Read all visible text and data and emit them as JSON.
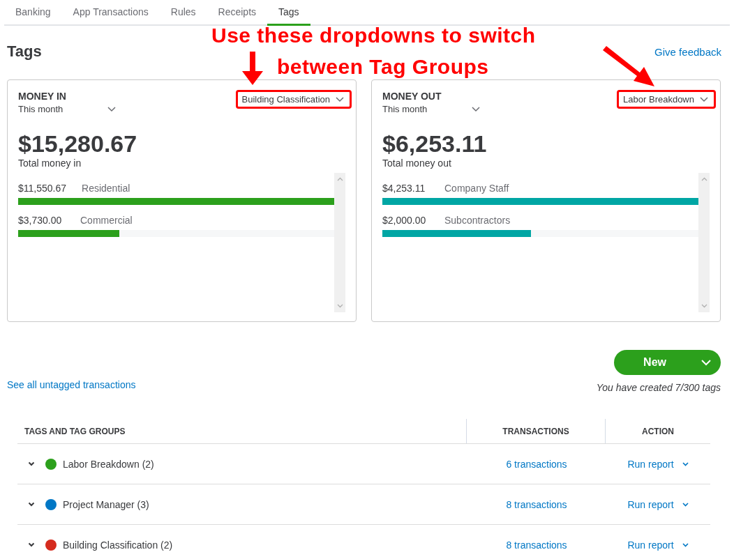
{
  "tabs": [
    {
      "label": "Banking",
      "selected": false
    },
    {
      "label": "App Transactions",
      "selected": false
    },
    {
      "label": "Rules",
      "selected": false
    },
    {
      "label": "Receipts",
      "selected": false
    },
    {
      "label": "Tags",
      "selected": true
    }
  ],
  "page_title": "Tags",
  "feedback_link": "Give feedback",
  "annotation": {
    "lines": [
      "Use these dropdowns to switch",
      "between Tag Groups"
    ]
  },
  "cards": [
    {
      "heading": "MONEY IN",
      "period": "This month",
      "tag_group": "Building Classification",
      "total": "$15,280.67",
      "total_label": "Total money in",
      "color": "#2ca01c",
      "items": [
        {
          "amount": "$11,550.67",
          "name": "Residential",
          "level": 1.0
        },
        {
          "amount": "$3,730.00",
          "name": "Commercial",
          "level": 0.32
        }
      ]
    },
    {
      "heading": "MONEY OUT",
      "period": "This month",
      "tag_group": "Labor Breakdown",
      "total": "$6,253.11",
      "total_label": "Total money out",
      "color": "#00a6a4",
      "items": [
        {
          "amount": "$4,253.11",
          "name": "Company Staff",
          "level": 1.0
        },
        {
          "amount": "$2,000.00",
          "name": "Subcontractors",
          "level": 0.47
        }
      ]
    }
  ],
  "new_button": "New",
  "untagged_link": "See all untagged transactions",
  "tag_count": "You have created 7/300 tags",
  "table": {
    "columns": [
      "TAGS AND TAG GROUPS",
      "TRANSACTIONS",
      "ACTION"
    ],
    "rows": [
      {
        "name": "Labor Breakdown (2)",
        "color": "#2ca01c",
        "transactions": "6 transactions",
        "action": "Run report"
      },
      {
        "name": "Project Manager (3)",
        "color": "#0077c5",
        "transactions": "8 transactions",
        "action": "Run report"
      },
      {
        "name": "Building Classification (2)",
        "color": "#d52b1e",
        "transactions": "8 transactions",
        "action": "Run report"
      }
    ]
  }
}
